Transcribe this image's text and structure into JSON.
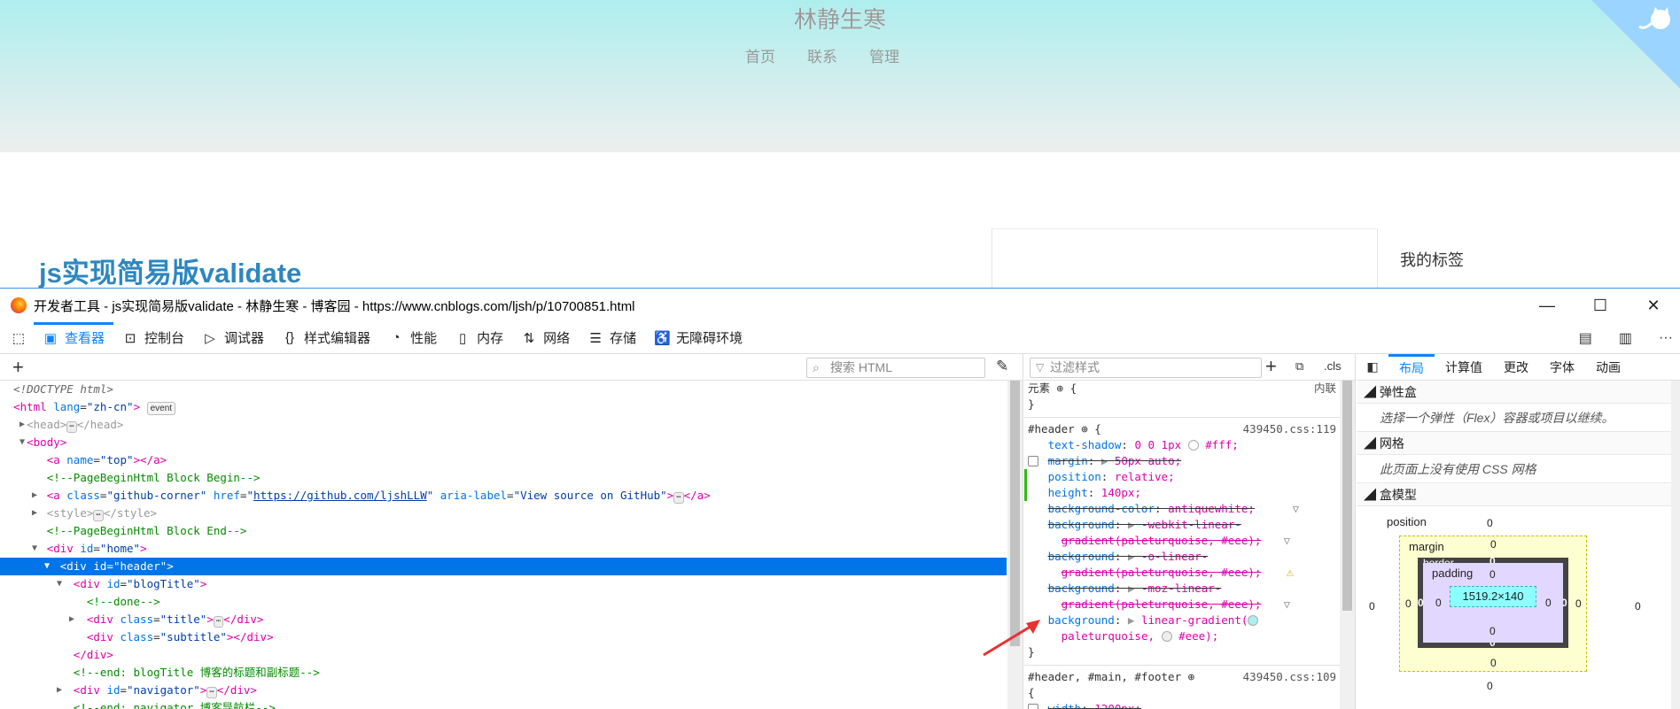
{
  "blog": {
    "title": "林静生寒",
    "nav": [
      "首页",
      "联系",
      "管理"
    ],
    "post_title": "js实现简易版validate",
    "sidebar_title": "我的标签"
  },
  "window": {
    "title": "开发者工具 - js实现简易版validate - 林静生寒 - 博客园 - https://www.cnblogs.com/ljsh/p/10700851.html",
    "minimize": "—",
    "maximize": "☐",
    "close": "✕"
  },
  "toolbar": {
    "tools": [
      {
        "label": "查看器",
        "icon": "inspector-icon"
      },
      {
        "label": "控制台",
        "icon": "console-icon"
      },
      {
        "label": "调试器",
        "icon": "debugger-icon"
      },
      {
        "label": "样式编辑器",
        "icon": "style-editor-icon"
      },
      {
        "label": "性能",
        "icon": "performance-icon"
      },
      {
        "label": "内存",
        "icon": "memory-icon"
      },
      {
        "label": "网络",
        "icon": "network-icon"
      },
      {
        "label": "存储",
        "icon": "storage-icon"
      },
      {
        "label": "无障碍环境",
        "icon": "accessibility-icon"
      }
    ],
    "more": "···"
  },
  "markup": {
    "search_placeholder": "搜索 HTML",
    "event_badge": "event",
    "lines": {
      "doctype": "<!DOCTYPE html>",
      "html_tag": "html",
      "html_lang_attr": "lang",
      "html_lang_val": "\"zh-cn\"",
      "head": "head",
      "body": "body",
      "a_top_attr": "name",
      "a_top_val": "\"top\"",
      "c_begin": "<!--PageBeginHtml Block Begin-->",
      "gh_class": "\"github-corner\"",
      "gh_href": "https://github.com/ljshLLW",
      "gh_aria": "\"View source on GitHub\"",
      "style": "style",
      "c_end": "<!--PageBeginHtml Block End-->",
      "home_id": "\"home\"",
      "header_id": "\"header\"",
      "blogtitle_id": "\"blogTitle\"",
      "c_done": "<!--done-->",
      "title_class": "\"title\"",
      "subtitle_class": "\"subtitle\"",
      "c_end_blogtitle": "<!--end: blogTitle 博客的标题和副标题-->",
      "navigator_id": "\"navigator\"",
      "c_end_nav": "<!--end: navigator 博客导航栏-->"
    }
  },
  "rules": {
    "filter_placeholder": "过滤样式",
    "cls": ".cls",
    "element_label": "元素",
    "element_inline": "内联",
    "rule1_selector": "#header",
    "rule1_source": "439450.css:119",
    "decls": [
      {
        "name": "text-shadow",
        "value": "0 0 1px",
        "extra": "#fff;"
      },
      {
        "name": "margin",
        "value": "50px auto;"
      },
      {
        "name": "position",
        "value": "relative;"
      },
      {
        "name": "height",
        "value": "140px;"
      },
      {
        "name": "background-color",
        "value": "antiquewhite;"
      },
      {
        "name": "background",
        "value": "-webkit-linear-",
        "cont": "gradient(paleturquoise, #eee);"
      },
      {
        "name": "background",
        "value": "-o-linear-",
        "cont": "gradient(paleturquoise, #eee);"
      },
      {
        "name": "background",
        "value": "-moz-linear-",
        "cont": "gradient(paleturquoise, #eee);"
      },
      {
        "name": "background",
        "value": "linear-gradient(",
        "cont": "paleturquoise,",
        "cont2": "#eee);"
      }
    ],
    "rule2_selector": "#header, #main, #footer",
    "rule2_source": "439450.css:109",
    "rule2_decl_name": "width",
    "rule2_decl_value": "1200px;"
  },
  "layout": {
    "tabs": [
      "布局",
      "计算值",
      "更改",
      "字体",
      "动画"
    ],
    "flexbox_title": "弹性盒",
    "flexbox_msg": "选择一个弹性（Flex）容器或项目以继续。",
    "grid_title": "网格",
    "grid_msg": "此页面上没有使用 CSS 网格",
    "boxmodel_title": "盒模型",
    "position_label": "position",
    "margin_label": "margin",
    "border_label": "border",
    "padding_label": "padding",
    "content_size": "1519.2×140",
    "zero": "0"
  },
  "colors": {
    "accent": "#0a84ff",
    "selection": "#0074e8",
    "blog_link": "#2c87c0",
    "header_gradient_from": "#afeeee",
    "header_gradient_to": "#eee",
    "annotation_arrow": "#e8322f"
  }
}
